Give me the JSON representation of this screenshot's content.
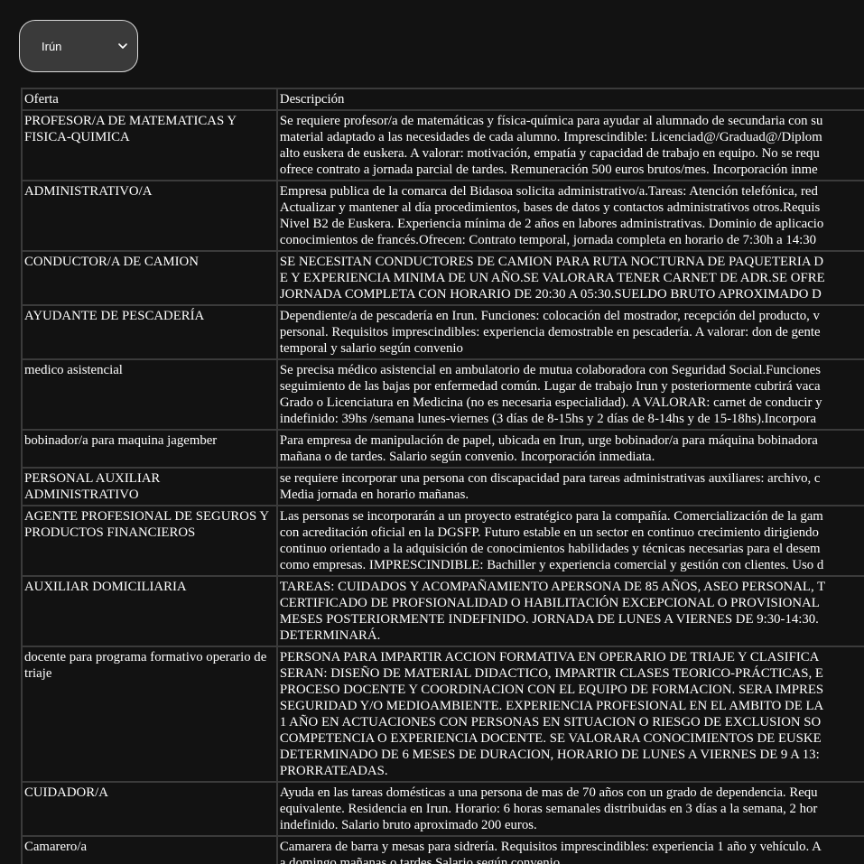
{
  "filter": {
    "selected": "Irún",
    "chevron_icon": "chevron-down-icon"
  },
  "table": {
    "headers": [
      "Oferta",
      "Descripción"
    ],
    "rows": [
      {
        "oferta": "PROFESOR/A DE MATEMATICAS Y FISICA-QUIMICA",
        "lines": [
          "Se requiere profesor/a de matemáticas y física-química para ayudar al alumnado de secundaria con su",
          "material adaptado a las necesidades de cada alumno. Imprescindible: Licenciad@/Graduad@/Diplom",
          "alto euskera de euskera. A valorar: motivación, empatía y capacidad de trabajo en equipo. No se requ",
          "ofrece contrato a jornada parcial de tardes. Remuneración 500 euros brutos/mes. Incorporación inme"
        ]
      },
      {
        "oferta": "ADMINISTRATIVO/A",
        "lines": [
          "Empresa publica de la comarca del Bidasoa solicita administrativo/a.Tareas: Atención telefónica, red",
          "Actualizar y mantener al día procedimientos, bases de datos y contactos administrativos otros.Requis",
          "Nivel B2 de Euskera. Experiencia mínima de 2 años en labores administrativas. Dominio de aplicacio",
          "conocimientos de francés.Ofrecen: Contrato temporal, jornada completa en horario de 7:30h a 14:30"
        ]
      },
      {
        "oferta": "CONDUCTOR/A DE CAMION",
        "lines": [
          "SE NECESITAN CONDUCTORES DE CAMION PARA RUTA NOCTURNA DE PAQUETERIA D",
          "E Y EXPERIENCIA MINIMA DE UN AÑO.SE VALORARA TENER CARNET DE ADR.SE OFRE",
          "JORNADA COMPLETA CON HORARIO DE 20:30 A 05:30.SUELDO BRUTO APROXIMADO D"
        ]
      },
      {
        "oferta": "AYUDANTE DE PESCADERÍA",
        "lines": [
          "Dependiente/a de pescadería en Irun. Funciones: colocación del mostrador, recepción del producto, v",
          "personal. Requisitos imprescindibles: experiencia demostrable en pescadería. A valorar: don de gente",
          "temporal y salario según convenio"
        ]
      },
      {
        "oferta": "medico asistencial",
        "lines": [
          "Se precisa médico asistencial en ambulatorio de mutua colaboradora con Seguridad Social.Funciones",
          "seguimiento de las bajas por enfermedad común. Lugar de trabajo Irun y posteriormente cubrirá vaca",
          "Grado o Licenciatura en Medicina (no es necesaria especialidad). A VALORAR: carnet de conducir y",
          "indefinido: 39hs /semana lunes-viernes (3 días de 8-15hs y 2 días de 8-14hs y de 15-18hs).Incorpora"
        ]
      },
      {
        "oferta": "bobinador/a para maquina jagember",
        "lines": [
          "Para empresa de manipulación de papel, ubicada en Irun, urge bobinador/a para máquina bobinadora",
          "mañana o de tardes. Salario según convenio. Incorporación inmediata."
        ]
      },
      {
        "oferta": "PERSONAL AUXILIAR ADMINISTRATIVO",
        "lines": [
          "se requiere incorporar una persona con discapacidad para tareas administrativas auxiliares: archivo, c",
          "Media jornada en horario mañanas."
        ]
      },
      {
        "oferta": "AGENTE PROFESIONAL DE SEGUROS Y PRODUCTOS FINANCIEROS",
        "lines": [
          "Las personas se incorporarán a un proyecto estratégico para la compañía. Comercialización de la gam",
          "con acreditación oficial en la DGSFP. Futuro estable en un sector en continuo crecimiento dirigiendo",
          "continuo orientado a la adquisición de conocimientos habilidades y técnicas necesarias para el desem",
          "como empresas. IMPRESCINDIBLE: Bachiller y experiencia comercial y gestión con clientes. Uso d"
        ]
      },
      {
        "oferta": "AUXILIAR DOMICILIARIA",
        "lines": [
          "TAREAS: CUIDADOS Y ACOMPAÑAMIENTO APERSONA DE 85 AÑOS, ASEO PERSONAL, T",
          "CERTIFICADO DE PROFSIONALIDAD O HABILITACIÓN EXCEPCIONAL O PROVISIONAL",
          "MESES POSTERIORMENTE INDEFINIDO. JORNADA DE LUNES A VIERNES DE 9:30-14:30.",
          "DETERMINARÁ."
        ]
      },
      {
        "oferta": "docente para programa formativo operario de triaje",
        "lines": [
          "PERSONA PARA IMPARTIR ACCION FORMATIVA EN OPERARIO DE TRIAJE Y CLASIFICA",
          "SERAN: DISEÑO DE MATERIAL DIDACTICO, IMPARTIR CLASES TEORICO-PRÁCTICAS, E",
          "PROCESO DOCENTE Y COORDINACION CON EL EQUIPO DE FORMACION. SERA IMPRES",
          "SEGURIDAD Y/O MEDIOAMBIENTE. EXPERIENCIA PROFESIONAL EN EL AMBITO DE LA",
          "1 AÑO EN ACTUACIONES CON PERSONAS EN SITUACION O RIESGO DE EXCLUSION SO",
          "COMPETENCIA O EXPERIENCIA DOCENTE. SE VALORARA CONOCIMIENTOS DE EUSKE",
          "DETERMINADO DE 6 MESES DE DURACION, HORARIO DE LUNES A VIERNES DE 9 A 13:",
          "PRORRATEADAS."
        ]
      },
      {
        "oferta": "CUIDADOR/A",
        "lines": [
          "Ayuda en las tareas domésticas a una persona de mas de 70 años con un grado de dependencia. Requ",
          "equivalente. Residencia en Irun. Horario: 6 horas semanales distribuidas en 3 días a la semana, 2 hor",
          "indefinido. Salario bruto aproximado 200 euros."
        ]
      },
      {
        "oferta": "Camarero/a",
        "lines": [
          "Camarera de barra y mesas para sidrería. Requisitos imprescindibles: experiencia 1 año y vehículo. A",
          "a domingo mañanas o tardes.Salario según convenio."
        ]
      }
    ]
  }
}
